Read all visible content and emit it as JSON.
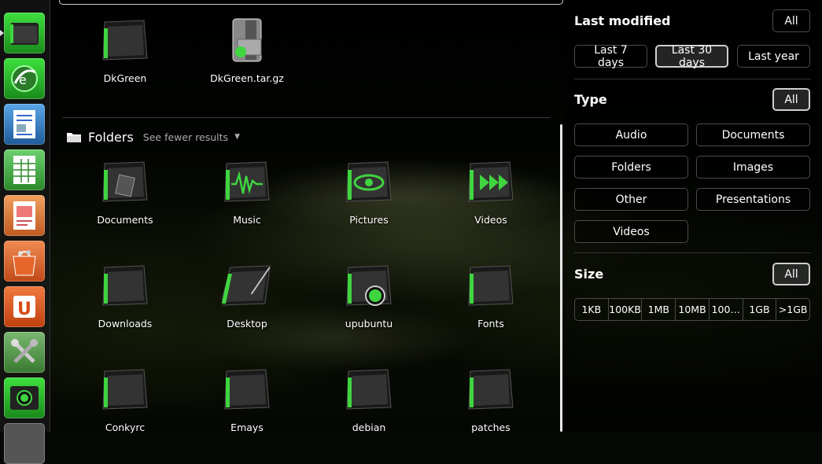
{
  "colors": {
    "accent": "#3fd53f",
    "panel": "#1a1a1a"
  },
  "launcher": {
    "items": [
      {
        "name": "files",
        "icon": "folder-icon",
        "color": "#2bbd2b"
      },
      {
        "name": "browser",
        "icon": "globe-icon",
        "color": "#2bbd2b"
      },
      {
        "name": "writer",
        "icon": "document-icon",
        "color": "#3a7fc8"
      },
      {
        "name": "calc",
        "icon": "spreadsheet-icon",
        "color": "#3aaa3a"
      },
      {
        "name": "impress",
        "icon": "presentation-icon",
        "color": "#d86a2a"
      },
      {
        "name": "software-center",
        "icon": "shopping-bag-icon",
        "color": "#e06a2a"
      },
      {
        "name": "ubuntu-one",
        "icon": "u-icon",
        "color": "#e05a20"
      },
      {
        "name": "settings",
        "icon": "tools-icon",
        "color": "#6aa060"
      },
      {
        "name": "camera",
        "icon": "webcam-icon",
        "color": "#2bbd2b"
      }
    ]
  },
  "top_files": [
    {
      "label": "DkGreen",
      "icon": "folder-icon"
    },
    {
      "label": "DkGreen.tar.gz",
      "icon": "archive-icon"
    }
  ],
  "folders_category": {
    "title": "Folders",
    "more": "See fewer results",
    "items": [
      {
        "label": "Documents",
        "icon": "documents-folder-icon"
      },
      {
        "label": "Music",
        "icon": "music-folder-icon"
      },
      {
        "label": "Pictures",
        "icon": "pictures-folder-icon"
      },
      {
        "label": "Videos",
        "icon": "videos-folder-icon"
      },
      {
        "label": "Downloads",
        "icon": "folder-icon"
      },
      {
        "label": "Desktop",
        "icon": "desktop-folder-icon"
      },
      {
        "label": "upubuntu",
        "icon": "ubuntu-folder-icon"
      },
      {
        "label": "Fonts",
        "icon": "folder-icon"
      },
      {
        "label": "Conkyrc",
        "icon": "folder-icon"
      },
      {
        "label": "Emays",
        "icon": "folder-icon"
      },
      {
        "label": "debian",
        "icon": "folder-icon"
      },
      {
        "label": "patches",
        "icon": "folder-icon"
      }
    ]
  },
  "filters": {
    "last_modified": {
      "title": "Last modified",
      "all": "All",
      "options": [
        "Last 7 days",
        "Last 30 days",
        "Last year"
      ],
      "selected": "Last 30 days"
    },
    "type": {
      "title": "Type",
      "all": "All",
      "options": [
        "Audio",
        "Documents",
        "Folders",
        "Images",
        "Other",
        "Presentations",
        "Videos"
      ]
    },
    "size": {
      "title": "Size",
      "all": "All",
      "options": [
        "1KB",
        "100KB",
        "1MB",
        "10MB",
        "100…",
        "1GB",
        ">1GB"
      ]
    }
  }
}
